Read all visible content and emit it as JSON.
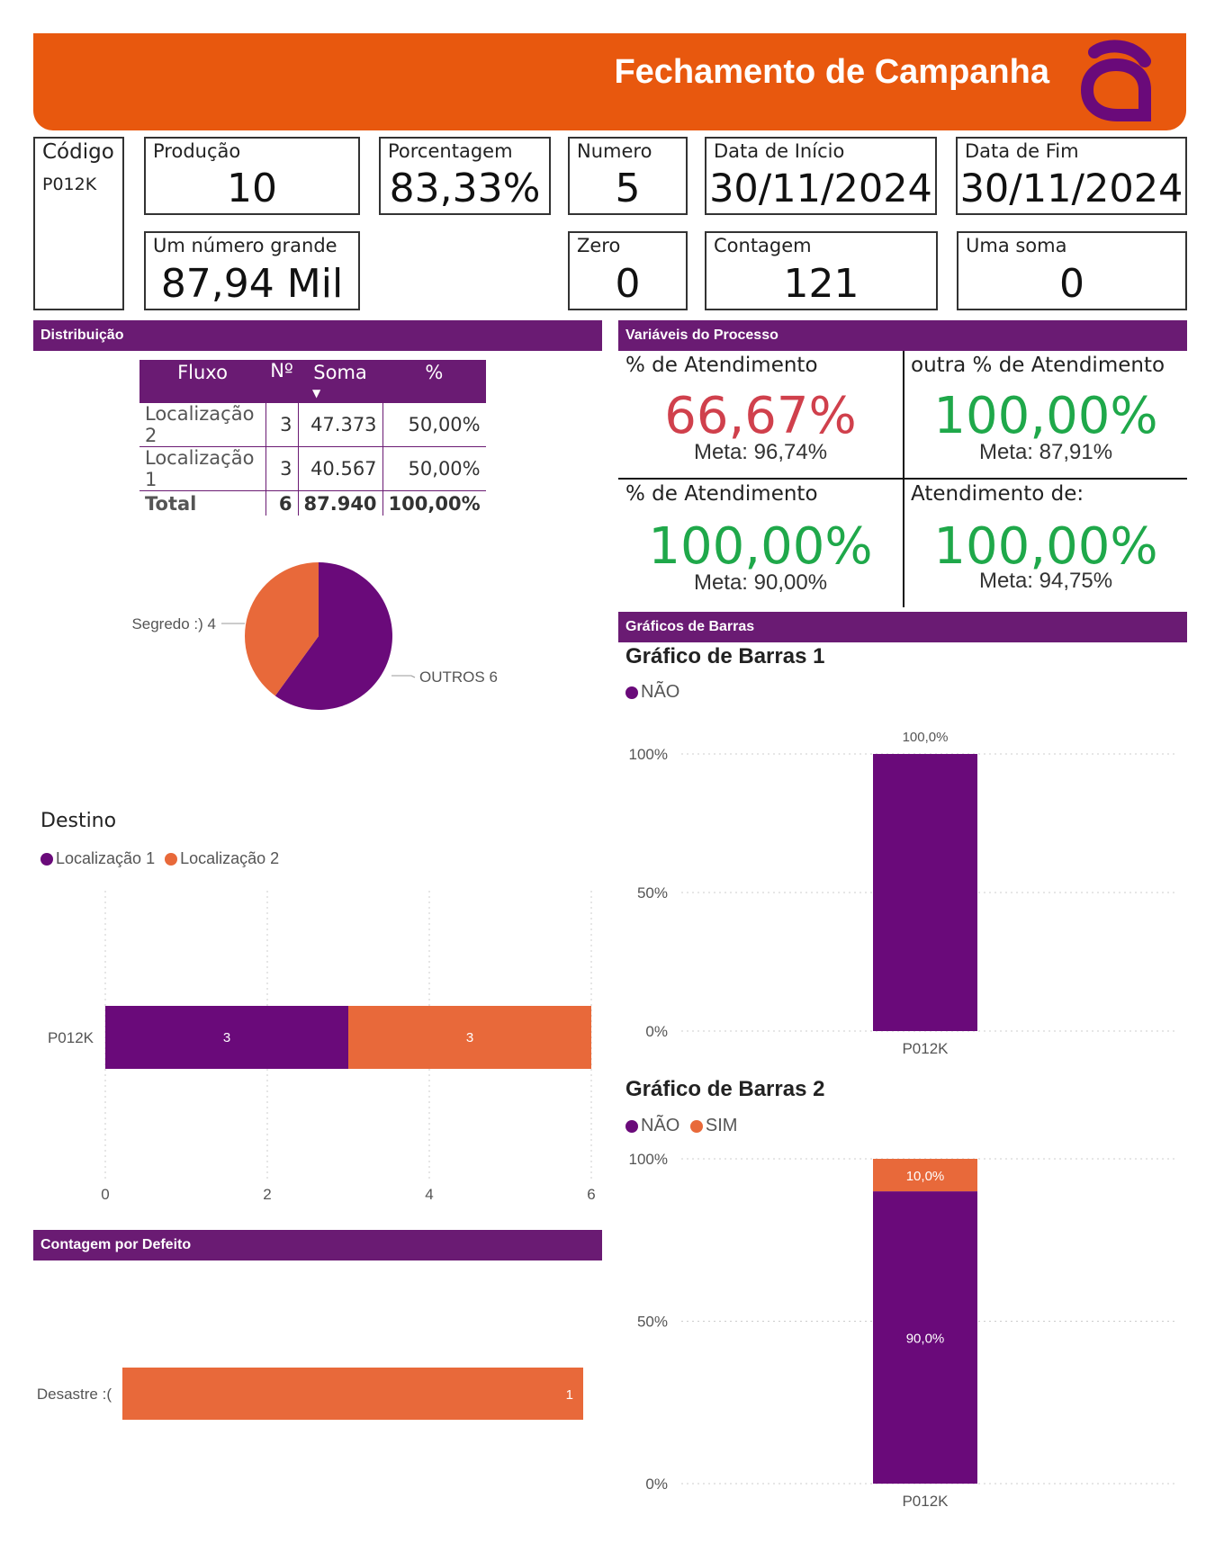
{
  "header": {
    "title": "Fechamento de Campanha",
    "logo_icon": "logo-a-icon",
    "color": "#e8580e"
  },
  "cards": {
    "codigo": {
      "label": "Código",
      "value": "P012K"
    },
    "producao": {
      "label": "Produção",
      "value": "10"
    },
    "porcentagem": {
      "label": "Porcentagem",
      "value": "83,33%"
    },
    "numero": {
      "label": "Numero",
      "value": "5"
    },
    "data_inicio": {
      "label": "Data de Início",
      "value": "30/11/2024"
    },
    "data_fim": {
      "label": "Data de Fim",
      "value": "30/11/2024"
    },
    "numero_grande": {
      "label": "Um número grande",
      "value": "87,94 Mil"
    },
    "zero": {
      "label": "Zero",
      "value": "0"
    },
    "contagem": {
      "label": "Contagem",
      "value": "121"
    },
    "soma": {
      "label": "Uma soma",
      "value": "0"
    }
  },
  "sections": {
    "distribuicao": "Distribuição",
    "variaveis": "Variáveis do Processo",
    "graficos": "Gráficos de Barras",
    "contagem_defeito": "Contagem por Defeito"
  },
  "table": {
    "headers": [
      "Fluxo",
      "Nº",
      "Soma",
      "%"
    ],
    "rows": [
      [
        "Localização 2",
        "3",
        "47.373",
        "50,00%"
      ],
      [
        "Localização 1",
        "3",
        "40.567",
        "50,00%"
      ]
    ],
    "total": [
      "Total",
      "6",
      "87.940",
      "100,00%"
    ]
  },
  "kpis": [
    {
      "label": "% de Atendimento",
      "value": "66,67%",
      "meta": "Meta: 96,74%",
      "color": "#d0404c"
    },
    {
      "label": "outra % de Atendimento",
      "value": "100,00%",
      "meta": "Meta: 87,91%",
      "color": "#1fa84a"
    },
    {
      "label": "% de Atendimento",
      "value": "100,00%",
      "meta": "Meta: 90,00%",
      "color": "#1fa84a"
    },
    {
      "label": "Atendimento de:",
      "value": "100,00%",
      "meta": "Meta: 94,75%",
      "color": "#1fa84a"
    }
  ],
  "colors": {
    "purple": "#6a0a7a",
    "orange": "#e8693a",
    "section": "#6a1b73"
  },
  "chart_data": [
    {
      "type": "pie",
      "categories": [
        "OUTROS",
        "Segredo :)"
      ],
      "values": [
        6,
        4
      ],
      "labels": [
        "OUTROS 6",
        "Segredo :) 4"
      ],
      "colors": [
        "#6a0a7a",
        "#e8693a"
      ]
    },
    {
      "type": "bar",
      "orientation": "horizontal",
      "stacked": true,
      "title": "Destino",
      "categories": [
        "P012K"
      ],
      "series": [
        {
          "name": "Localização 1",
          "values": [
            3
          ],
          "color": "#6a0a7a"
        },
        {
          "name": "Localização 2",
          "values": [
            3
          ],
          "color": "#e8693a"
        }
      ],
      "xlim": [
        0,
        6
      ],
      "xticks": [
        "0",
        "2",
        "4",
        "6"
      ],
      "legend": "top-left",
      "grid": true
    },
    {
      "type": "bar",
      "title": "Gráfico de Barras 1",
      "categories": [
        "P012K"
      ],
      "series": [
        {
          "name": "NÃO",
          "values": [
            100
          ],
          "labels": [
            "100,0%"
          ],
          "color": "#6a0a7a"
        }
      ],
      "ylim": [
        0,
        100
      ],
      "yticks": [
        "0%",
        "50%",
        "100%"
      ],
      "legend": "top-left",
      "grid": true
    },
    {
      "type": "bar",
      "stacked": true,
      "title": "Gráfico de Barras 2",
      "categories": [
        "P012K"
      ],
      "series": [
        {
          "name": "NÃO",
          "values": [
            90
          ],
          "labels": [
            "90,0%"
          ],
          "color": "#6a0a7a"
        },
        {
          "name": "SIM",
          "values": [
            10
          ],
          "labels": [
            "10,0%"
          ],
          "color": "#e8693a"
        }
      ],
      "ylim": [
        0,
        100
      ],
      "yticks": [
        "0%",
        "50%",
        "100%"
      ],
      "legend": "top-left",
      "grid": true
    },
    {
      "type": "bar",
      "orientation": "horizontal",
      "categories": [
        "Desastre :("
      ],
      "values": [
        1
      ],
      "labels": [
        "1"
      ],
      "color": "#e8693a"
    }
  ]
}
